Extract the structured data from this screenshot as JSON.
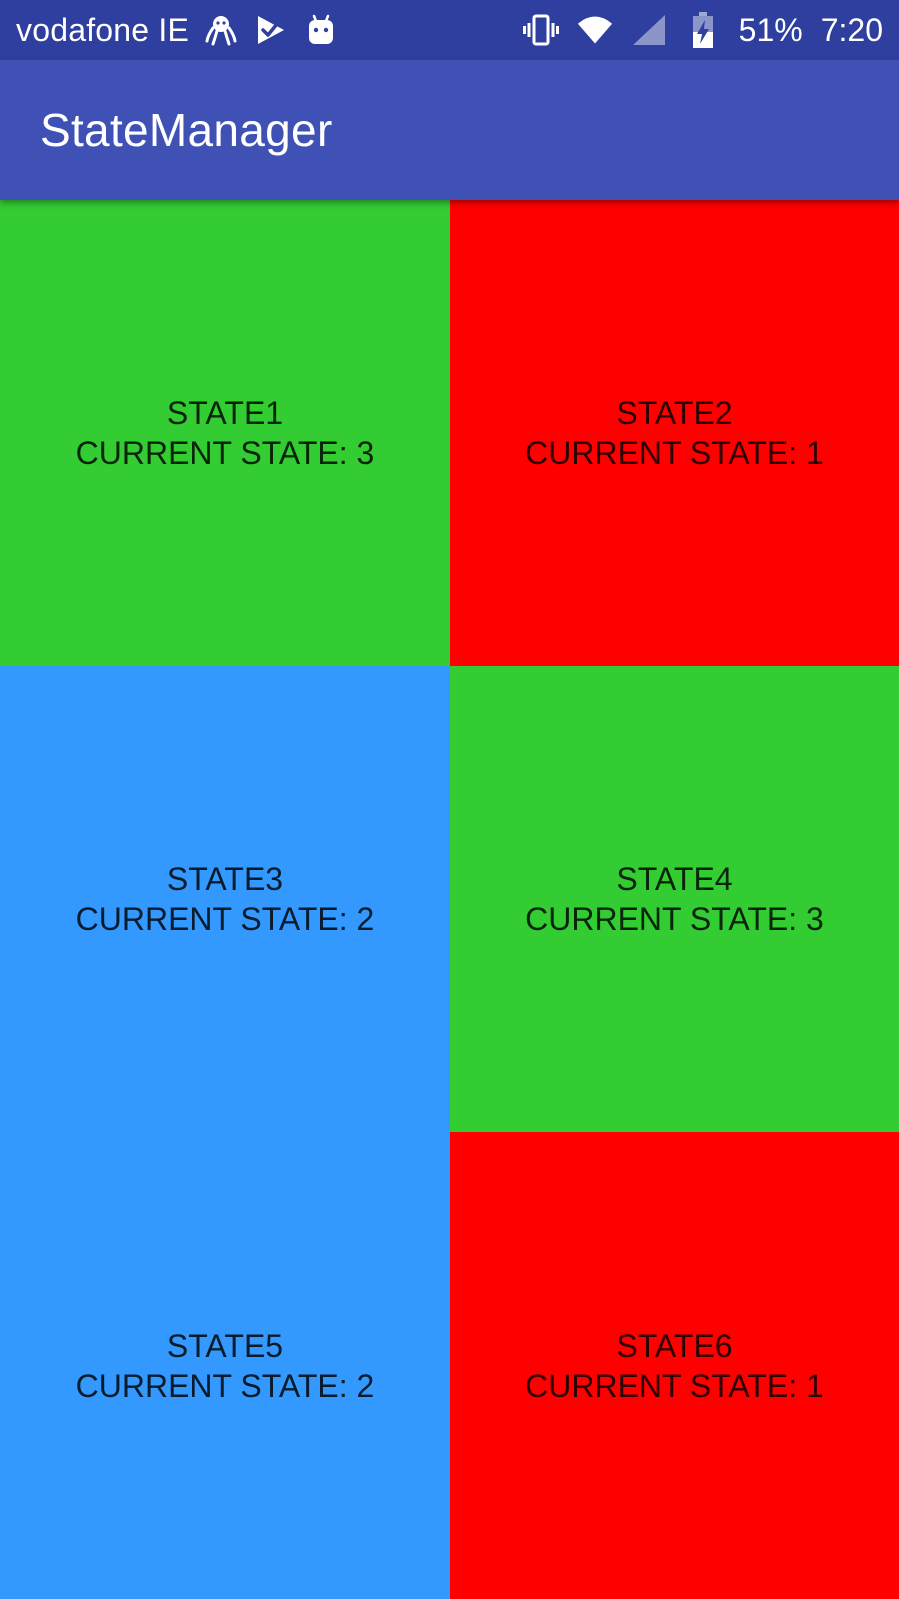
{
  "status_bar": {
    "carrier": "vodafone IE",
    "battery_percent": "51%",
    "time": "7:20",
    "left_icons": [
      "octopus-icon",
      "play-check-icon",
      "android-icon"
    ],
    "right_icons": [
      "vibrate-icon",
      "wifi-icon",
      "signal-icon",
      "battery-charging-icon"
    ],
    "background_color": "#2f3f9f"
  },
  "app_bar": {
    "title": "StateManager",
    "background_color": "#3f51b5"
  },
  "tiles": [
    {
      "name": "STATE1",
      "current_label": "CURRENT STATE:",
      "current_value": "3",
      "color": "#33cc33"
    },
    {
      "name": "STATE2",
      "current_label": "CURRENT STATE:",
      "current_value": "1",
      "color": "#ff0000"
    },
    {
      "name": "STATE3",
      "current_label": "CURRENT STATE:",
      "current_value": "2",
      "color": "#3399ff"
    },
    {
      "name": "STATE4",
      "current_label": "CURRENT STATE:",
      "current_value": "3",
      "color": "#33cc33"
    },
    {
      "name": "STATE5",
      "current_label": "CURRENT STATE:",
      "current_value": "2",
      "color": "#3399ff"
    },
    {
      "name": "STATE6",
      "current_label": "CURRENT STATE:",
      "current_value": "1",
      "color": "#ff0000"
    }
  ]
}
